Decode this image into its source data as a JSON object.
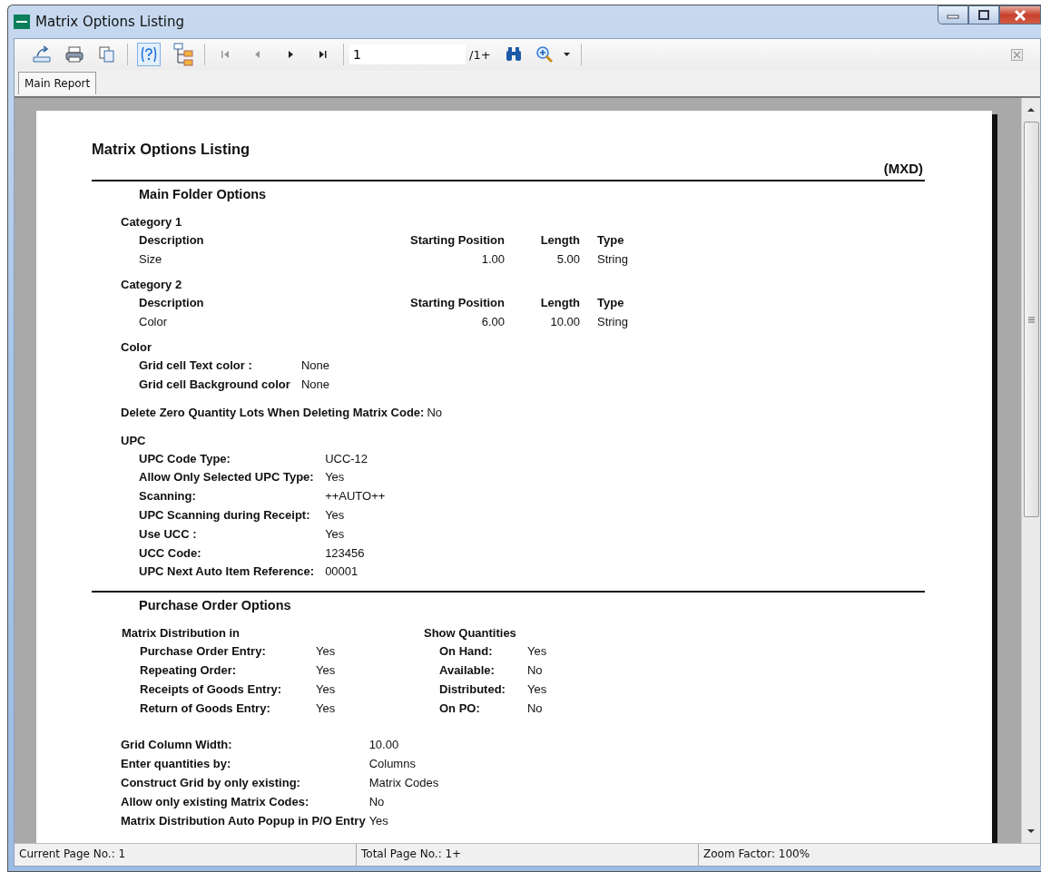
{
  "window": {
    "title": "Matrix Options Listing"
  },
  "toolbar": {
    "page_field": {
      "value": "1"
    },
    "page_total": "/1+"
  },
  "tabs": [
    {
      "label": "Main Report",
      "selected": true
    }
  ],
  "report": {
    "title": "Matrix Options Listing",
    "code": "(MXD)",
    "blocks": [
      {
        "kind": "rule"
      },
      {
        "kind": "heading",
        "text": "Main Folder Options"
      },
      {
        "kind": "group",
        "text": "Category 1"
      },
      {
        "kind": "table",
        "columns": [
          "Description",
          "Starting Position",
          "Length",
          "Type"
        ],
        "rows": [
          [
            "Size",
            "1.00",
            "5.00",
            "String"
          ]
        ]
      },
      {
        "kind": "group",
        "text": "Category 2"
      },
      {
        "kind": "table",
        "columns": [
          "Description",
          "Starting Position",
          "Length",
          "Type"
        ],
        "rows": [
          [
            "Color",
            "6.00",
            "10.00",
            "String"
          ]
        ]
      },
      {
        "kind": "group",
        "text": "Color"
      },
      {
        "kind": "fields",
        "rows": [
          {
            "label": "Grid cell Text color :",
            "value": "None"
          },
          {
            "label": "Grid cell Background color",
            "value": "None"
          }
        ]
      },
      {
        "kind": "line",
        "label": "Delete Zero Quantity Lots When Deleting Matrix Code:",
        "value": "No"
      },
      {
        "kind": "group",
        "text": "UPC"
      },
      {
        "kind": "fields",
        "rows": [
          {
            "label": "UPC Code Type:",
            "value": "UCC-12"
          },
          {
            "label": "Allow Only Selected UPC Type:",
            "value": "Yes"
          },
          {
            "label": "Scanning:",
            "value": "++AUTO++"
          },
          {
            "label": "UPC Scanning during Receipt:",
            "value": "Yes"
          },
          {
            "label": "Use UCC :",
            "value": "Yes"
          },
          {
            "label": "UCC Code:",
            "value": "123456"
          },
          {
            "label": "UPC Next Auto Item Reference:",
            "value": "00001"
          }
        ]
      },
      {
        "kind": "rule"
      },
      {
        "kind": "heading",
        "text": "Purchase Order Options"
      },
      {
        "kind": "columns",
        "columns": [
          {
            "title": "Matrix Distribution in",
            "rows": [
              {
                "label": "Purchase Order Entry:",
                "value": "Yes"
              },
              {
                "label": "Repeating Order:",
                "value": "Yes"
              },
              {
                "label": "Receipts of Goods Entry:",
                "value": "Yes"
              },
              {
                "label": "Return of Goods Entry:",
                "value": "Yes"
              }
            ]
          },
          {
            "title": "Show Quantities",
            "rows": [
              {
                "label": "On Hand:",
                "value": "Yes"
              },
              {
                "label": "Available:",
                "value": "No"
              },
              {
                "label": "Distributed:",
                "value": "Yes"
              },
              {
                "label": "On PO:",
                "value": "No"
              }
            ]
          }
        ]
      },
      {
        "kind": "flat_fields",
        "rows": [
          {
            "label": "Grid Column Width:",
            "value": "10.00"
          },
          {
            "label": "Enter quantities by:",
            "value": "Columns"
          },
          {
            "label": "Construct Grid by only existing:",
            "value": "Matrix Codes"
          },
          {
            "label": "Allow only existing Matrix Codes:",
            "value": "No"
          },
          {
            "label": "Matrix Distribution Auto Popup in P/O Entry",
            "value": "Yes"
          }
        ]
      }
    ]
  },
  "status_bar": [
    "Current Page No.: 1",
    "Total Page No.: 1+",
    "Zoom Factor: 100%"
  ]
}
